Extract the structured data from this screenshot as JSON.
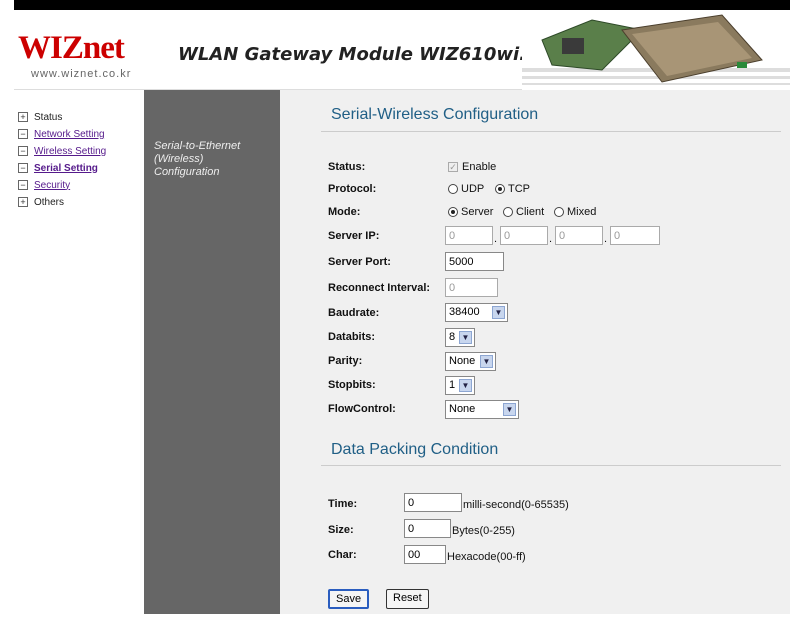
{
  "header": {
    "logo_brand": "WIZnet",
    "logo_url": "www.wiznet.co.kr",
    "title": "WLAN Gateway Module WIZ610wi...."
  },
  "sidebar": {
    "items": [
      {
        "icon": "plus-icon",
        "box": "+",
        "label": "Status"
      },
      {
        "icon": "minus-icon",
        "box": "−",
        "label": "Network Setting"
      },
      {
        "icon": "minus-icon",
        "box": "−",
        "label": "Wireless Setting"
      },
      {
        "icon": "minus-icon",
        "box": "−",
        "label": "Serial Setting"
      },
      {
        "icon": "minus-icon",
        "box": "−",
        "label": "Security"
      },
      {
        "icon": "plus-icon",
        "box": "+",
        "label": "Others"
      }
    ]
  },
  "side_caption": [
    "Serial-to-Ethernet",
    "(Wireless)",
    "Configuration"
  ],
  "serial": {
    "section_title": "Serial-Wireless Configuration",
    "status_label": "Status:",
    "status_option": "Enable",
    "protocol_label": "Protocol:",
    "protocol_options": [
      "UDP",
      "TCP"
    ],
    "protocol_selected": "TCP",
    "mode_label": "Mode:",
    "mode_options": [
      "Server",
      "Client",
      "Mixed"
    ],
    "mode_selected": "Server",
    "server_ip_label": "Server IP:",
    "server_ip": [
      "0",
      "0",
      "0",
      "0"
    ],
    "ip_dot": ".",
    "server_port_label": "Server Port:",
    "server_port": "5000",
    "reconnect_label": "Reconnect Interval:",
    "reconnect_value": "0",
    "baudrate_label": "Baudrate:",
    "baudrate_value": "38400",
    "databits_label": "Databits:",
    "databits_value": "8",
    "parity_label": "Parity:",
    "parity_value": "None",
    "stopbits_label": "Stopbits:",
    "stopbits_value": "1",
    "flow_label": "FlowControl:",
    "flow_value": "None"
  },
  "packing": {
    "section_title": "Data Packing Condition",
    "time_label": "Time:",
    "time_value": "0",
    "time_unit": "milli-second(0-65535)",
    "size_label": "Size:",
    "size_value": "0",
    "size_unit": "Bytes(0-255)",
    "char_label": "Char:",
    "char_value": "00",
    "char_unit": "Hexacode(00-ff)"
  },
  "buttons": {
    "save": "Save",
    "reset": "Reset"
  },
  "colors": {
    "section_title": "#205f86",
    "gray_column": "#666666",
    "main_bg": "#f0f0f0"
  }
}
